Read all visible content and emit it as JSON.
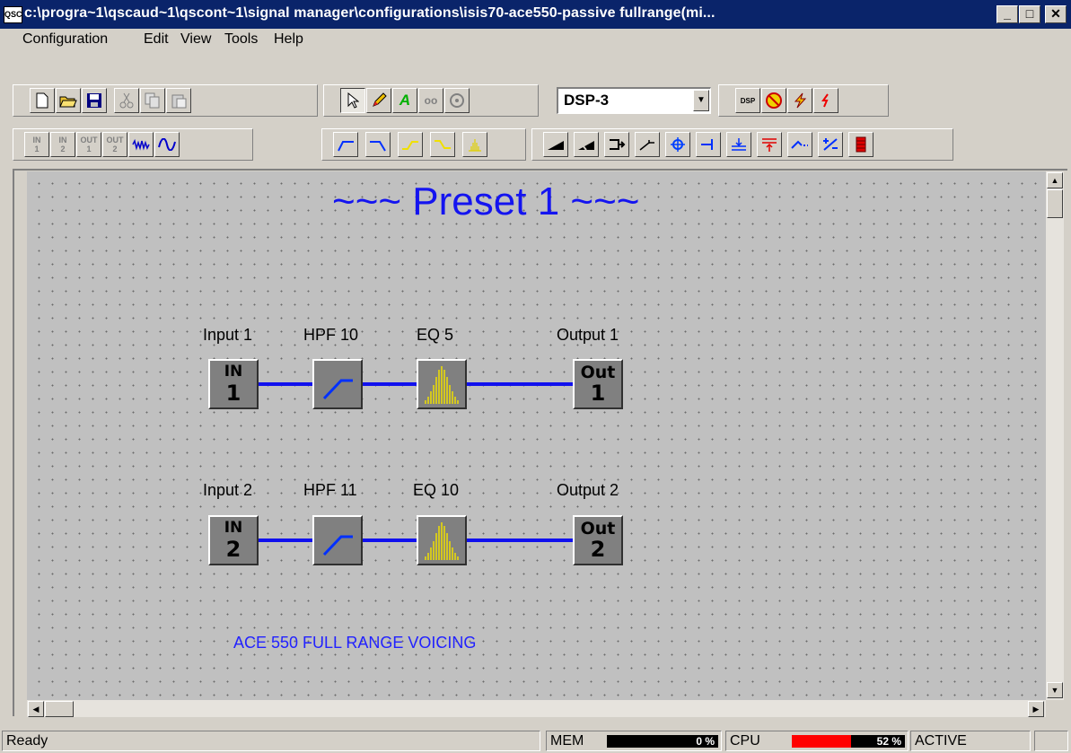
{
  "window": {
    "app_icon_text": "QSC",
    "title": "c:\\progra~1\\qscaud~1\\qscont~1\\signal manager\\configurations\\isis70-ace550-passive fullrange(mi...",
    "minimize": "_",
    "maximize": "□",
    "close": "✕"
  },
  "menu": [
    "Configuration",
    "Edit",
    "View",
    "Tools",
    "Help"
  ],
  "toolbar": {
    "dsp_selected": "DSP-3",
    "io_buttons": [
      {
        "top": "IN",
        "bottom": "1"
      },
      {
        "top": "IN",
        "bottom": "2"
      },
      {
        "top": "OUT",
        "bottom": "1"
      },
      {
        "top": "OUT",
        "bottom": "2"
      }
    ],
    "text_tool_glyph": "A",
    "link_tool_glyph": "oo",
    "dsp_button_glyph": "DSP"
  },
  "canvas": {
    "preset_title": "~~~ Preset 1 ~~~",
    "note": "ACE 550 FULL RANGE VOICING",
    "rows": [
      {
        "input_label": "Input 1",
        "input_top": "IN",
        "input_num": "1",
        "hpf_label": "HPF 10",
        "eq_label": "EQ 5",
        "output_label": "Output 1",
        "output_top": "Out",
        "output_num": "1"
      },
      {
        "input_label": "Input 2",
        "input_top": "IN",
        "input_num": "2",
        "hpf_label": "HPF 11",
        "eq_label": "EQ 10",
        "output_label": "Output 2",
        "output_top": "Out",
        "output_num": "2"
      }
    ]
  },
  "status": {
    "text": "Ready",
    "mem_label": "MEM",
    "mem_value": "0 %",
    "mem_fraction": 0,
    "cpu_label": "CPU",
    "cpu_value": "52 %",
    "cpu_fraction": 0.52,
    "state": "ACTIVE",
    "colors": {
      "cpu_bar": "#ff0000",
      "meter_bg": "#000000"
    }
  }
}
